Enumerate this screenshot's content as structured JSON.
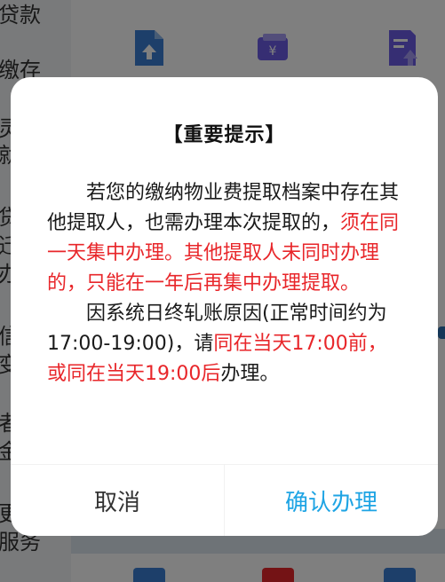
{
  "background": {
    "sidebar_items": [
      {
        "label": "贷款"
      },
      {
        "label": "缴存"
      },
      {
        "label": "灵"
      },
      {
        "label": "就"
      },
      {
        "label": "贷"
      },
      {
        "label": "迁"
      },
      {
        "label": "办"
      },
      {
        "label": "信"
      },
      {
        "label": "变"
      },
      {
        "label": "者"
      },
      {
        "label": "金"
      },
      {
        "label": "更"
      },
      {
        "label": "服务"
      }
    ],
    "icons": [
      "document-upload-icon",
      "money-card-icon",
      "document-tree-icon"
    ]
  },
  "dialog": {
    "title": "【重要提示】",
    "paragraph1": {
      "normal": "若您的缴纳物业费提取档案中存在其他提取人，也需办理本次提取的，",
      "red": "须在同一天集中办理。其他提取人未同时办理的，只能在一年后再集中办理提取。"
    },
    "paragraph2": {
      "normal_start": "因系统日终轧账原因(正常时间约为17:00-19:00)，请",
      "red": "同在当天17:00前，或同在当天19:00后",
      "normal_end": "办理。"
    },
    "cancel_label": "取消",
    "confirm_label": "确认办理"
  },
  "colors": {
    "accent": "#1ea4e4",
    "warning": "#e8262a",
    "overlay": "rgba(0,0,0,0.5)"
  }
}
